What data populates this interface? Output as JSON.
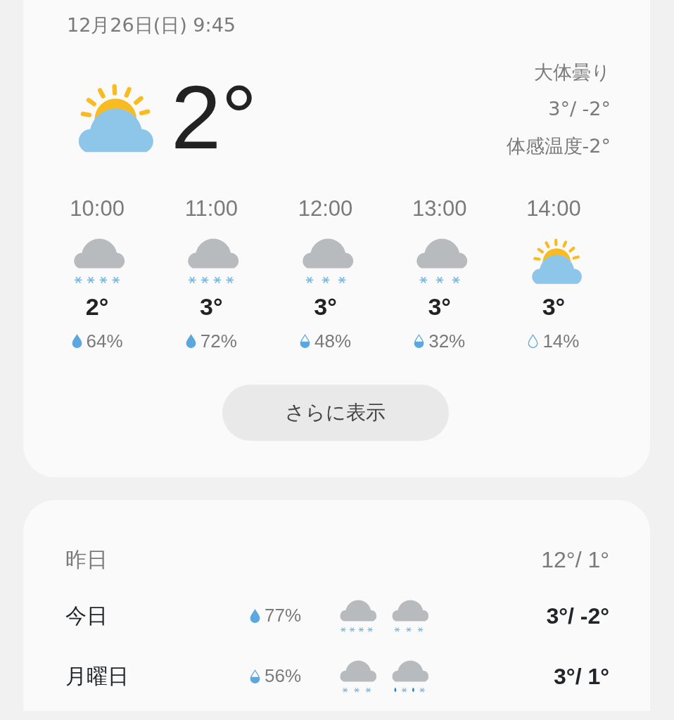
{
  "current": {
    "datetime": "12月26日(日) 9:45",
    "kind": "partly_cloudy",
    "temperature": "2°",
    "condition": "大体曇り",
    "high_low": "3°/ -2°",
    "feels_like": "体感温度-2°"
  },
  "hourly": [
    {
      "time": "10:00",
      "kind": "heavy_snow",
      "temperature": "2°",
      "precipitation": "64%",
      "drop": {
        "kind": "full"
      }
    },
    {
      "time": "11:00",
      "kind": "heavy_snow",
      "temperature": "3°",
      "precipitation": "72%",
      "drop": {
        "kind": "full"
      }
    },
    {
      "time": "12:00",
      "kind": "snow",
      "temperature": "3°",
      "precipitation": "48%",
      "drop": {
        "kind": "half"
      }
    },
    {
      "time": "13:00",
      "kind": "snow",
      "temperature": "3°",
      "precipitation": "32%",
      "drop": {
        "kind": "half"
      }
    },
    {
      "time": "14:00",
      "kind": "partly_cloudy",
      "temperature": "3°",
      "precipitation": "14%",
      "drop": {
        "kind": "empty"
      }
    }
  ],
  "more_button": "さらに表示",
  "daily": [
    {
      "day": "昨日",
      "kind": "past",
      "high_low": "12°/ 1°"
    },
    {
      "day": "今日",
      "kind": "forecast",
      "precipitation": "77%",
      "drop": {
        "kind": "full"
      },
      "icons": [
        {
          "kind": "heavy_snow"
        },
        {
          "kind": "snow"
        }
      ],
      "high_low": "3°/ -2°"
    },
    {
      "day": "月曜日",
      "kind": "forecast",
      "precipitation": "56%",
      "drop": {
        "kind": "half"
      },
      "icons": [
        {
          "kind": "snow"
        },
        {
          "kind": "sleet"
        }
      ],
      "high_low": "3°/ 1°"
    }
  ]
}
